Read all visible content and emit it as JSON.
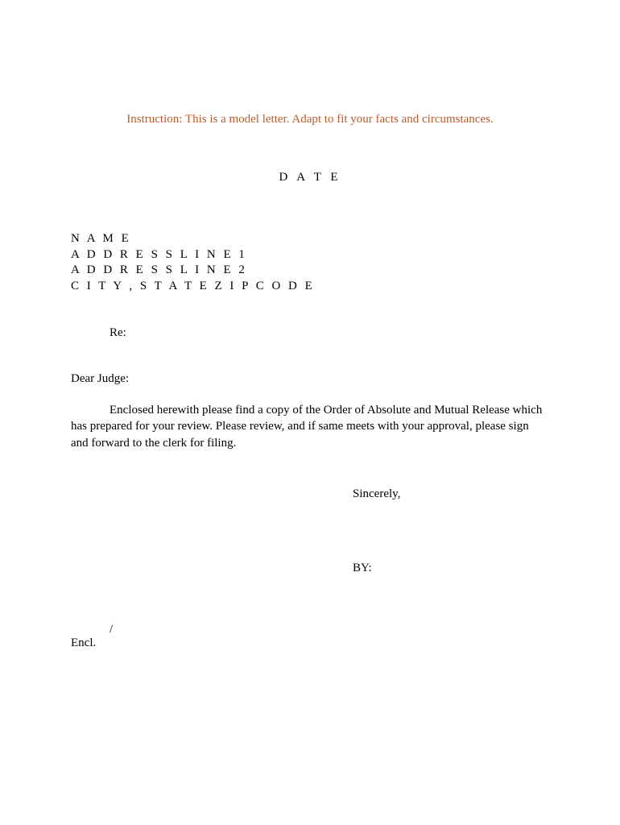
{
  "instruction": "Instruction:  This is a model letter.  Adapt to fit your facts and circumstances.",
  "date": "D A T E",
  "address": {
    "name": "N A M E",
    "line1": "A D D R E S S  L I N E  1",
    "line2": "A D D R E S S  L I N E  2",
    "city_state_zip": "C I T Y , S T A T E  Z I P  C O D E"
  },
  "re": "Re:",
  "salutation": "Dear Judge:",
  "body": "Enclosed herewith please find a copy of the Order of Absolute and Mutual Release which has prepared for your review.  Please review, and if same meets with your approval, please sign and forward to the clerk for filing.",
  "closing": "Sincerely,",
  "by": "BY:",
  "slash": "/",
  "encl": "Encl."
}
